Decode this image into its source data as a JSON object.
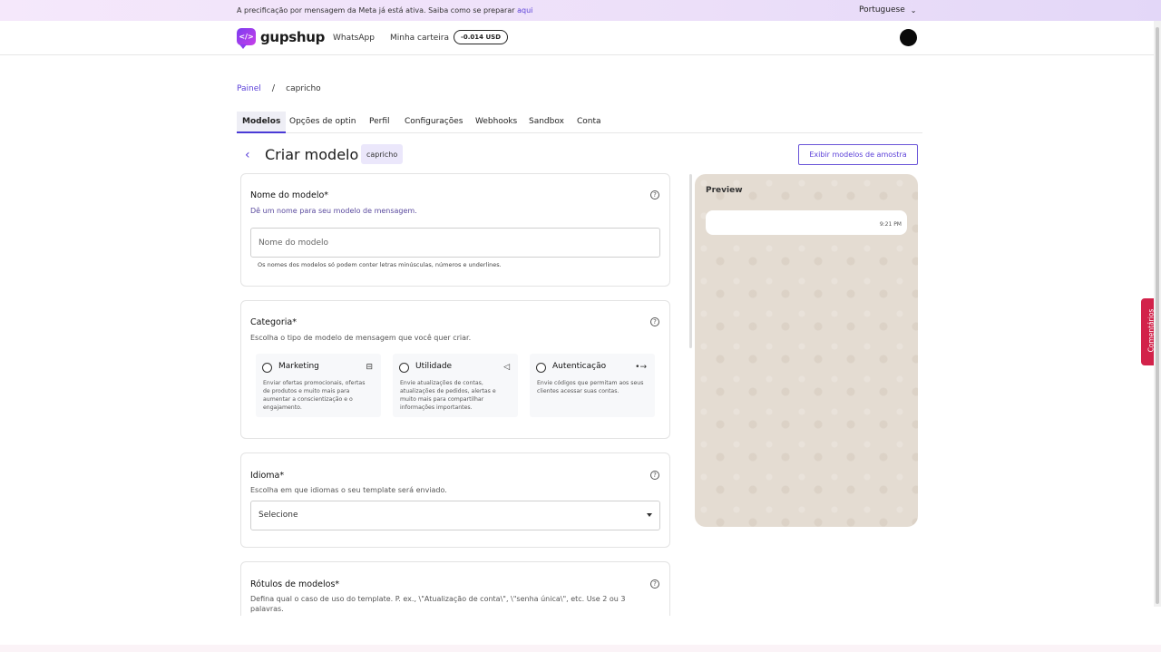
{
  "banner": {
    "text": "A precificação por mensagem da Meta já está ativa. Saiba como se preparar",
    "link": "aqui",
    "language": "Portuguese"
  },
  "nav": {
    "logo_text": "gupshup",
    "logo_glyph": "</>",
    "links": [
      "WhatsApp",
      "Minha carteira"
    ],
    "wallet_balance": "-0.014 USD"
  },
  "breadcrumb": {
    "root": "Painel",
    "separator": "/",
    "current": "capricho"
  },
  "tabs": [
    "Modelos",
    "Opções de optin",
    "Perfil",
    "Configurações",
    "Webhooks",
    "Sandbox",
    "Conta"
  ],
  "header": {
    "back_glyph": "‹",
    "title": "Criar modelo",
    "app_chip": "capricho",
    "sample_button": "Exibir modelos de amostra"
  },
  "template_name": {
    "title": "Nome do modelo*",
    "description": "Dê um nome para seu modelo de mensagem.",
    "placeholder": "Nome do modelo",
    "hint": "Os nomes dos modelos só podem conter letras minúsculas, números e underlines."
  },
  "category": {
    "title": "Categoria*",
    "description": "Escolha o tipo de modelo de mensagem que você quer criar.",
    "options": [
      {
        "label": "Marketing",
        "icon": "briefcase-icon",
        "glyph": "⊟",
        "description": "Enviar ofertas promocionais, ofertas de produtos e muito mais para aumentar a conscientização e o engajamento."
      },
      {
        "label": "Utilidade",
        "icon": "megaphone-icon",
        "glyph": "◁",
        "description": "Envie atualizações de contas, atualizações de pedidos, alertas e muito mais para compartilhar informações importantes."
      },
      {
        "label": "Autenticação",
        "icon": "key-login-icon",
        "glyph": "•→",
        "description": "Envie códigos que permitam aos seus clientes acessar suas contas."
      }
    ]
  },
  "language": {
    "title": "Idioma*",
    "description": "Escolha em que idiomas o seu template será enviado.",
    "select_value": "Selecione"
  },
  "labels": {
    "title": "Rótulos de modelos*",
    "description": "Defina qual o caso de uso do template. P. ex., \\\"Atualização de conta\\\", \\\"senha única\\\", etc. Use 2 ou 3 palavras."
  },
  "help_glyph": "?",
  "preview": {
    "title": "Preview",
    "time": "9:21 PM"
  },
  "feedback": {
    "label": "Comentários"
  },
  "colors": {
    "accent": "#5a3fd8",
    "feedback": "#d2224a",
    "preview_bg": "#e4dcd2"
  }
}
